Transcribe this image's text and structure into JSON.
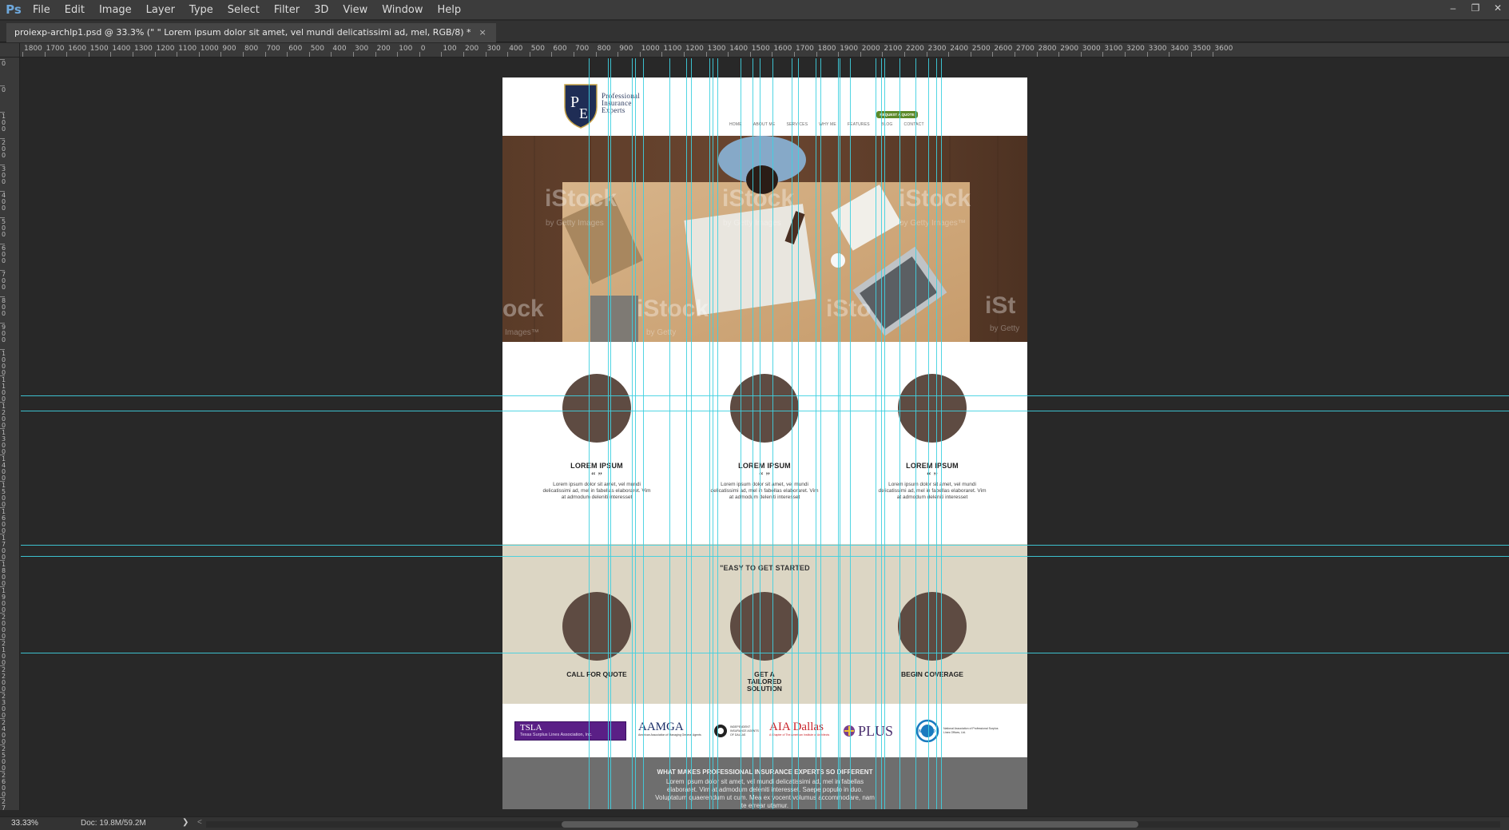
{
  "app": {
    "logo": "Ps"
  },
  "menu": [
    "File",
    "Edit",
    "Image",
    "Layer",
    "Type",
    "Select",
    "Filter",
    "3D",
    "View",
    "Window",
    "Help"
  ],
  "window_controls": [
    "–",
    "❐",
    "✕"
  ],
  "document_tab": {
    "title": "proiexp-archlp1.psd @ 33.3% (\" \" Lorem ipsum dolor sit amet, vel mundi delicatissimi ad, mel, RGB/8) *",
    "close": "×"
  },
  "ruler_h_labels": [
    "1800",
    "1700",
    "1600",
    "1500",
    "1400",
    "1300",
    "1200",
    "1100",
    "1000",
    "900",
    "800",
    "700",
    "600",
    "500",
    "400",
    "300",
    "200",
    "100",
    "0",
    "100",
    "200",
    "300",
    "400",
    "500",
    "600",
    "700",
    "800",
    "900",
    "1000",
    "1100",
    "1200",
    "1300",
    "1400",
    "1500",
    "1600",
    "1700",
    "1800",
    "1900",
    "2000",
    "2100",
    "2200",
    "2300",
    "2400",
    "2500",
    "2600",
    "2700",
    "2800",
    "2900",
    "3000",
    "3100",
    "3200",
    "3300",
    "3400",
    "3500",
    "3600"
  ],
  "ruler_v_labels": [
    "0",
    "0",
    "100",
    "200",
    "300",
    "400",
    "500",
    "600",
    "700",
    "800",
    "900",
    "1000",
    "1100",
    "1200",
    "1300",
    "1400",
    "1500",
    "1600",
    "1700",
    "1800",
    "1900",
    "2000",
    "2100",
    "2200",
    "2300",
    "2400",
    "2500",
    "2600",
    "2700",
    "2800"
  ],
  "site": {
    "logo_initials": "PE",
    "logo_lines": [
      "Professional",
      "Insurance",
      "Experts"
    ],
    "nav": [
      "HOME",
      "ABOUT ME",
      "SERVICES",
      "WHY ME",
      "FEATURES",
      "BLOG",
      "CONTACT"
    ],
    "quote_button": "REQUEST A QUOTE",
    "hero_watermarks": [
      {
        "big": "iStock",
        "small": "by Getty Images"
      },
      {
        "big": "iStock",
        "small": "by Getty Images"
      },
      {
        "big": "iStock",
        "small": "by Getty Images™"
      },
      {
        "big": "ock",
        "small": "Images™"
      },
      {
        "big": "iStock",
        "small": "by Getty"
      },
      {
        "big": "iSto",
        "small": ""
      },
      {
        "big": "iSt",
        "small": "by Getty"
      }
    ],
    "features": [
      {
        "title": "LOREM IPSUM",
        "quote": "“ ”",
        "body": "Lorem ipsum dolor sit amet, vel mundi delicatissimi ad, mel in fabellas elaboraret. Vim at admodum deleniti interesset"
      },
      {
        "title": "LOREM IPSUM",
        "quote": "“ ”",
        "body": "Lorem ipsum dolor sit amet, vel mundi delicatissimi ad, mel in fabellas elaboraret. Vim at admodum deleniti interesset"
      },
      {
        "title": "LOREM IPSUM",
        "quote": "“ ”",
        "body": "Lorem ipsum dolor sit amet, vel mundi delicatissimi ad, mel in fabellas elaboraret. Vim at admodum deleniti interesset"
      }
    ],
    "steps_title": "\"EASY TO GET STARTED",
    "steps": [
      {
        "label": "CALL FOR QUOTE"
      },
      {
        "label": "GET A TAILORED SOLUTION"
      },
      {
        "label": "BEGIN COVERAGE"
      }
    ],
    "partners": [
      {
        "name": "TSLA",
        "sub": "Texas Surplus Lines Association, Inc."
      },
      {
        "name": "AAMGA",
        "sub": "American Association of Managing General Agents"
      },
      {
        "name": "INDEPENDENT INSURANCE AGENTS OF DALLAS",
        "sub": ""
      },
      {
        "name": "AIA Dallas",
        "sub": "A Chapter of The American Institute of Architects"
      },
      {
        "name": "PLUS",
        "sub": ""
      },
      {
        "name": "NAPSLO",
        "sub": "National Association of Professional Surplus Lines Offices, Ltd."
      }
    ],
    "footer_title": "WHAT MAKES PROFESSIONAL INSURANCE EXPERTS SO DIFFERENT",
    "footer_text": "Lorem ipsum dolor sit amet, vel mundi delicatissimi ad, mel in fabellas elaboraret. Vim at admodum deleniti interesset. Saepe populo in duo. Voluptatum quaerendum ut cum. Mea ex vocent volumus accommodare, nam te errear utamur."
  },
  "status": {
    "zoom": "33.33%",
    "doc": "Doc: 19.8M/59.2M",
    "arrow": "❯",
    "scroll_left": "<"
  },
  "colors": {
    "guide": "#3fd0e0",
    "circle": "#5e4b42",
    "steps_bg": "#dcd6c4",
    "footer_bg": "#6e6e6e",
    "ps_blue": "#6ea8dc"
  }
}
